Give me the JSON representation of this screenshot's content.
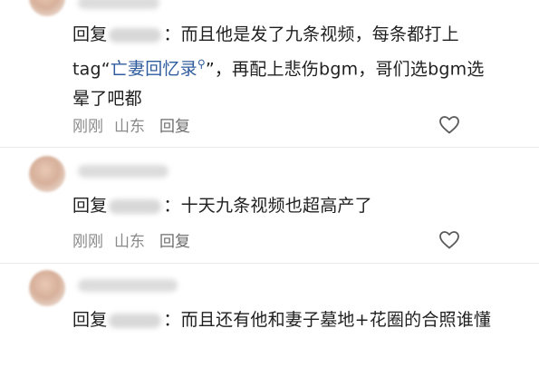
{
  "comments": [
    {
      "reply_label": "回复",
      "content_before_tag": "：而且他是发了九条视频，每条都打上tag“",
      "tag": "亡妻回忆录",
      "tag_icon": "search-icon",
      "content_after_tag": "”，再配上悲伤bgm，哥们选bgm选晕了吧都",
      "time": "刚刚",
      "location": "山东",
      "reply_action": "回复"
    },
    {
      "reply_label": "回复",
      "content": "：十天九条视频也超高产了",
      "time": "刚刚",
      "location": "山东",
      "reply_action": "回复"
    },
    {
      "reply_label": "回复",
      "content": "：而且还有他和妻子墓地+花圈的合照谁懂"
    }
  ],
  "icons": {
    "like": "heart-outline-icon"
  },
  "colors": {
    "tag": "#2f5c9e",
    "meta": "#8a8a8a",
    "text": "#1f1f1f"
  }
}
